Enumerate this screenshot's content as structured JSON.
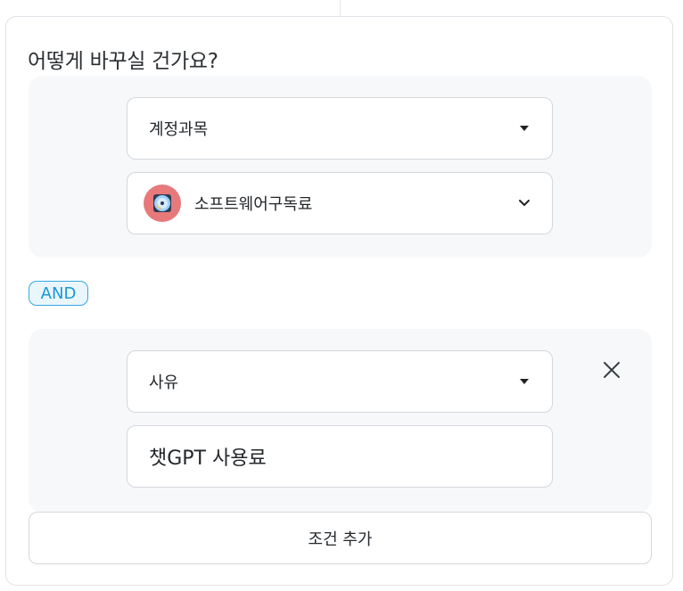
{
  "title": "어떻게 바꾸실 건가요?",
  "condition_group_1": {
    "category_select": {
      "value": "계정과목"
    },
    "account_select": {
      "value": "소프트웨어구독료",
      "icon": "software-disc-icon",
      "icon_color": "#e7797b"
    }
  },
  "operator": {
    "label": "AND"
  },
  "condition_group_2": {
    "field_select": {
      "value": "사유"
    },
    "text_input": {
      "value": "챗GPT 사용료"
    }
  },
  "actions": {
    "add_condition_label": "조건 추가"
  },
  "colors": {
    "accent": "#1a96d8",
    "panel_bg": "#f7f8fa",
    "border": "#d4d7db"
  }
}
